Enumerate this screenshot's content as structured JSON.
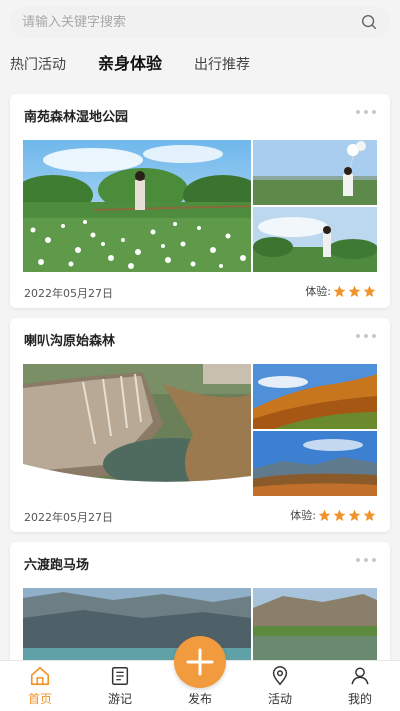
{
  "search": {
    "placeholder": "请输入关键字搜索",
    "value": ""
  },
  "tabs": [
    {
      "label": "热门活动",
      "active": false
    },
    {
      "label": "亲身体验",
      "active": true
    },
    {
      "label": "出行推荐",
      "active": false
    }
  ],
  "cards": [
    {
      "title": "南苑森林湿地公园",
      "date": "2022年05月27日",
      "rating_label": "体验:",
      "rating": 3,
      "rating_max": 3
    },
    {
      "title": "喇叭沟原始森林",
      "date": "2022年05月27日",
      "rating_label": "体验:",
      "rating": 4,
      "rating_max": 4
    },
    {
      "title": "六渡跑马场"
    }
  ],
  "nav": {
    "home": "首页",
    "notes": "游记",
    "publish": "发布",
    "activity": "活动",
    "mine": "我的"
  },
  "colors": {
    "accent": "#f29a3e",
    "active_nav": "#f0932b",
    "star": "#f0932b"
  }
}
